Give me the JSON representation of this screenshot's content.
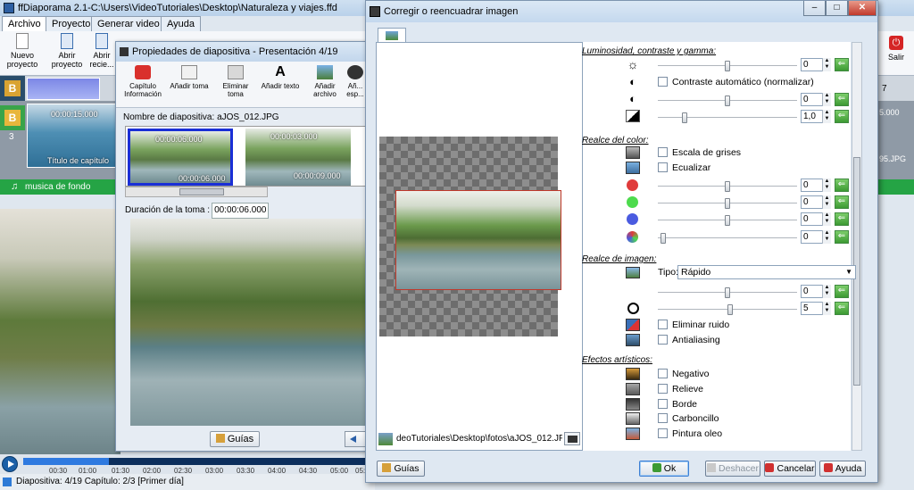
{
  "main": {
    "title": "ffDiaporama 2.1-C:\\Users\\VideoTutoriales\\Desktop\\Naturaleza y viajes.ffd",
    "tabs": [
      "Archivo",
      "Proyecto",
      "Generar video",
      "Ayuda"
    ],
    "ribbon": {
      "new_project": "Nuevo proyecto",
      "open_project": "Abrir proyecto",
      "recent": "Abrir recie...",
      "exit": "Salir"
    },
    "timeline_numbers": [
      "1",
      "7"
    ],
    "track_b_num": "3",
    "chapter_time": "00:00:15.000",
    "chapter_title": "Título de capítulo",
    "right_time": "5.000",
    "right_file": "95.JPG",
    "music_label": "musica de fondo",
    "ticks": [
      "00:30",
      "01:00",
      "01:30",
      "02:00",
      "02:30",
      "03:00",
      "03:30",
      "04:00",
      "04:30",
      "05:00",
      "05:30"
    ],
    "status": "Diapositiva: 4/19   Capítulo: 2/3 [Primer día]"
  },
  "dialog1": {
    "title": "Propiedades de diapositiva - Presentación 4/19",
    "toolbar": [
      "Capítulo Información",
      "Añadir toma",
      "Eliminar toma",
      "Añadir texto",
      "Añadir archivo",
      "Añ... esp..."
    ],
    "slide_name_label": "Nombre de diapositiva:",
    "slide_name_value": "aJOS_012.JPG",
    "thumbs": [
      {
        "top_time": "00:00:06.000",
        "bottom_time": "00:00:06.000"
      },
      {
        "top_time": "00:00:03.000",
        "bottom_time": "00:00:09.000"
      }
    ],
    "duration_label": "Duración de la toma :",
    "duration_value": "00:00:06.000",
    "guias": "Guías"
  },
  "dialog2": {
    "title": "Corregir o reencuadrar imagen",
    "window_buttons": {
      "min": "–",
      "max": "□",
      "close": "✕"
    },
    "file_path": "deoTutoriales\\Desktop\\fotos\\aJOS_012.JPG",
    "sections": {
      "luminosity": "Luminosidad, contraste y gamma:",
      "color": "Realce del color:",
      "image": "Realce de imagen:",
      "artistic": "Efectos artísticos:"
    },
    "lum_rows": [
      {
        "value": "0",
        "knob": 0.5
      },
      {
        "value": "0",
        "knob": 0.5
      },
      {
        "value": "1,0",
        "knob": 0.18
      }
    ],
    "contraste_auto": "Contraste automático (normalizar)",
    "grayscale": "Escala de grises",
    "equalize": "Ecualizar",
    "color_rows": [
      {
        "value": "0",
        "knob": 0.5,
        "color": "#e03b3b"
      },
      {
        "value": "0",
        "knob": 0.5,
        "color": "#4ddb4d"
      },
      {
        "value": "0",
        "knob": 0.5,
        "color": "#4a5be0"
      },
      {
        "value": "0",
        "knob": 0.02,
        "color": "#888888"
      }
    ],
    "tipo_label": "Tipo:",
    "tipo_value": "Rápido",
    "image_rows": [
      {
        "value": "0",
        "knob": 0.5
      },
      {
        "value": "5",
        "knob": 0.52
      }
    ],
    "noise": "Eliminar ruido",
    "antialias": "Antialiasing",
    "artistic": [
      "Negativo",
      "Relieve",
      "Borde",
      "Carboncillo",
      "Pintura oleo"
    ],
    "buttons": {
      "guias": "Guías",
      "ok": "Ok",
      "deshacer": "Deshacer",
      "cancelar": "Cancelar",
      "ayuda": "Ayuda"
    }
  }
}
